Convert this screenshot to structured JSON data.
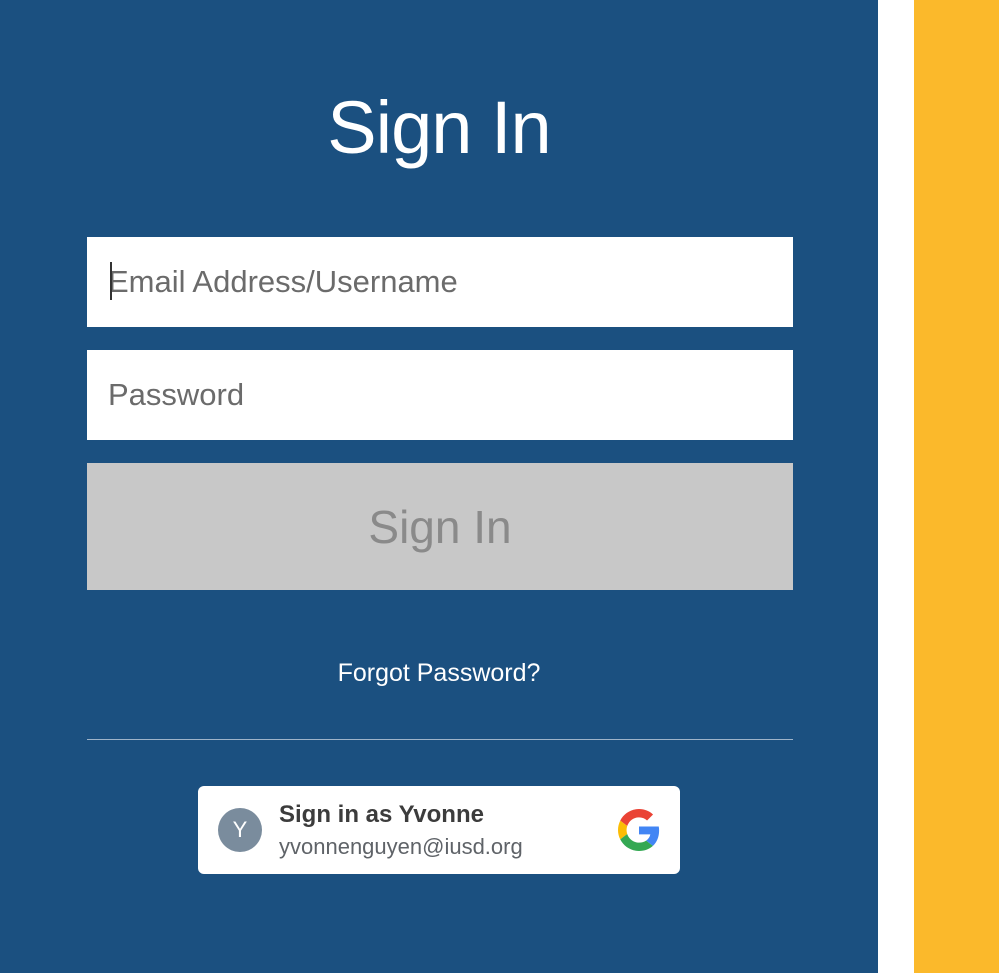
{
  "signin": {
    "title": "Sign In",
    "email_placeholder": "Email Address/Username",
    "email_value": "",
    "password_placeholder": "Password",
    "password_value": "",
    "submit_label": "Sign In",
    "forgot_label": "Forgot Password?"
  },
  "google": {
    "avatar_initial": "Y",
    "primary_label": "Sign in as Yvonne",
    "email": "yvonnenguyen@iusd.org",
    "logo_icon": "google-g-icon"
  },
  "colors": {
    "panel_background": "#1b5080",
    "accent_stripe": "#fbb92b",
    "button_disabled": "#c8c8c8",
    "avatar_background": "#7a8c9d"
  }
}
